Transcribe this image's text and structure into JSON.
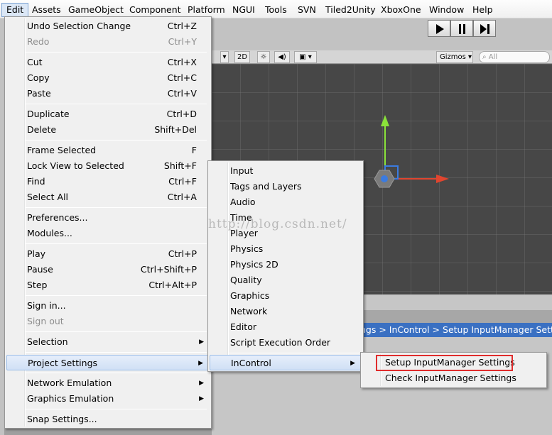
{
  "menubar": {
    "items": [
      "Edit",
      "Assets",
      "GameObject",
      "Component",
      "Platform",
      "NGUI",
      "Tools",
      "SVN",
      "Tiled2Unity",
      "XboxOne",
      "Window",
      "Help"
    ],
    "active": "Edit"
  },
  "edit_menu": {
    "undo": {
      "label": "Undo Selection Change",
      "shortcut": "Ctrl+Z"
    },
    "redo": {
      "label": "Redo",
      "shortcut": "Ctrl+Y"
    },
    "cut": {
      "label": "Cut",
      "shortcut": "Ctrl+X"
    },
    "copy": {
      "label": "Copy",
      "shortcut": "Ctrl+C"
    },
    "paste": {
      "label": "Paste",
      "shortcut": "Ctrl+V"
    },
    "duplicate": {
      "label": "Duplicate",
      "shortcut": "Ctrl+D"
    },
    "delete": {
      "label": "Delete",
      "shortcut": "Shift+Del"
    },
    "frame_selected": {
      "label": "Frame Selected",
      "shortcut": "F"
    },
    "lock_view": {
      "label": "Lock View to Selected",
      "shortcut": "Shift+F"
    },
    "find": {
      "label": "Find",
      "shortcut": "Ctrl+F"
    },
    "select_all": {
      "label": "Select All",
      "shortcut": "Ctrl+A"
    },
    "preferences": {
      "label": "Preferences..."
    },
    "modules": {
      "label": "Modules..."
    },
    "play": {
      "label": "Play",
      "shortcut": "Ctrl+P"
    },
    "pause": {
      "label": "Pause",
      "shortcut": "Ctrl+Shift+P"
    },
    "step": {
      "label": "Step",
      "shortcut": "Ctrl+Alt+P"
    },
    "sign_in": {
      "label": "Sign in..."
    },
    "sign_out": {
      "label": "Sign out"
    },
    "selection": {
      "label": "Selection"
    },
    "project_settings": {
      "label": "Project Settings"
    },
    "network_emulation": {
      "label": "Network Emulation"
    },
    "graphics_emulation": {
      "label": "Graphics Emulation"
    },
    "snap_settings": {
      "label": "Snap Settings..."
    }
  },
  "project_settings_menu": {
    "items": [
      "Input",
      "Tags and Layers",
      "Audio",
      "Time",
      "Player",
      "Physics",
      "Physics 2D",
      "Quality",
      "Graphics",
      "Network",
      "Editor",
      "Script Execution Order"
    ],
    "incontrol": "InControl"
  },
  "incontrol_menu": {
    "setup": "Setup InputManager Settings",
    "check": "Check InputManager Settings"
  },
  "scene_toolbar": {
    "mode_2d": "2D",
    "gizmos": "Gizmos",
    "search_placeholder": "All"
  },
  "status_bar": {
    "text": "ngs > InControl > Setup InputManager Setting"
  },
  "watermark": "http://blog.csdn.net/",
  "colors": {
    "highlight": "#d0e0f5",
    "red_box": "#e02c2c",
    "status_bar": "#3a70c2",
    "scene_bg": "#474747"
  }
}
